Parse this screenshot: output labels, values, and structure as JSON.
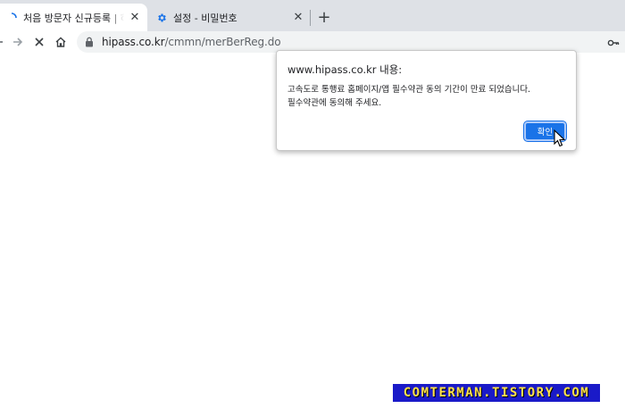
{
  "browser": {
    "tabs": [
      {
        "title": "처음 방문자 신규등록 | 하이패스",
        "active": true,
        "favicon": "loading-spinner-icon"
      },
      {
        "title": "설정 - 비밀번호",
        "active": false,
        "favicon": "gear-icon"
      }
    ],
    "close_glyph": "✕",
    "newtab_glyph": "+",
    "address": {
      "domain": "hipass.co.kr",
      "path": "/cmmn/merBerReg.do"
    }
  },
  "dialog": {
    "origin": "www.hipass.co.kr 내용:",
    "message_line1": "고속도로 통행료 홈페이지/앱 필수약관 동의 기간이 만료 되었습니다.",
    "message_line2": "필수약관에 동의해 주세요.",
    "ok_label": "확인"
  },
  "watermark": {
    "text": "COMTERMAN.TISTORY.COM"
  },
  "colors": {
    "accent": "#1a73e8",
    "tabstrip": "#dee1e6",
    "omnibox": "#f1f3f4",
    "watermark_bg": "#1a1ac8",
    "watermark_text": "#ffe14a"
  }
}
